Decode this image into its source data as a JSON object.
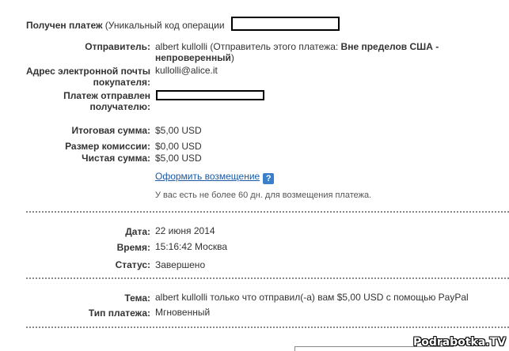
{
  "header": {
    "bold": "Получен платеж",
    "rest": " (Уникальный код операции"
  },
  "sender": {
    "label": "Отправитель:",
    "name": "albert kullolli",
    "note_open": " (Отправитель этого платежа: ",
    "status_line1": "Вне пределов США -",
    "status_line2": "непроверенный",
    "note_close": ")"
  },
  "email": {
    "label_line1": "Адрес электронной почты",
    "label_line2": "покупателя:",
    "value": "kullolli@alice.it"
  },
  "recipient": {
    "label_line1": "Платеж отправлен",
    "label_line2": "получателю:"
  },
  "amounts": [
    {
      "label": "Итоговая сумма:",
      "value": "$5,00 USD"
    },
    {
      "label": "Размер комиссии:",
      "value": "$0,00 USD"
    },
    {
      "label": "Чистая сумма:",
      "value": "$5,00 USD"
    }
  ],
  "refund": {
    "link": "Оформить возмещение",
    "help_icon": "?",
    "note": "У вас есть не более 60 дн. для возмещения платежа."
  },
  "details": [
    {
      "label": "Дата:",
      "value": "22 июня 2014"
    },
    {
      "label": "Время:",
      "value": "15:16:42 Москва"
    },
    {
      "label": "Статус:",
      "value": "Завершено"
    }
  ],
  "subject": {
    "label": "Тема:",
    "value": "albert kullolli только что отправил(-а) вам $5,00 USD с помощью PayPal"
  },
  "payment_type": {
    "label": "Тип платежа:",
    "value": "Мгновенный"
  },
  "watermark": "Podrabotka.TV"
}
